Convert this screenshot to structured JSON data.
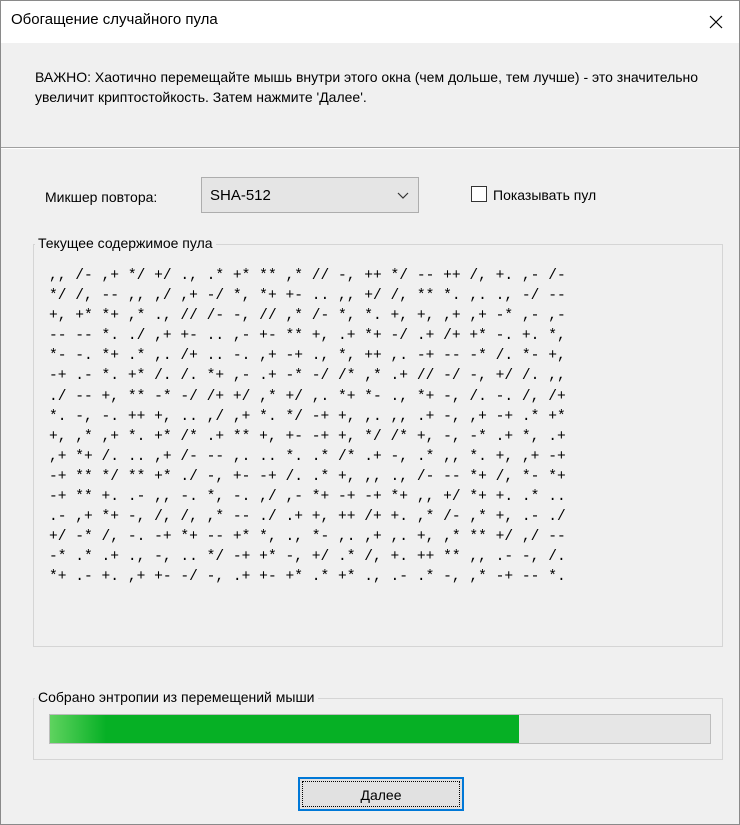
{
  "window": {
    "title": "Обогащение случайного пула",
    "close_icon": "close-icon"
  },
  "important_text": "ВАЖНО: Хаотично перемещайте мышь внутри этого окна (чем дольше, тем лучше) - это значительно увеличит криптостойкость. Затем нажмите 'Далее'.",
  "mixer": {
    "label": "Микшер повтора:",
    "value": "SHA-512",
    "arrow_icon": "chevron-down-icon"
  },
  "show_pool": {
    "label": "Показывать пул",
    "checked": false
  },
  "pool": {
    "group_title": "Текущее содержимое пула",
    "lines": [
      ",, /- ,+ */ +/ ., .* +* ** ,* // -, ++ */ -- ++ /, +. ,- /-",
      "*/ /, -- ,, ,/ ,+ -/ *, *+ +- .. ,, +/ /, ** *. ,. ., -/ --",
      "+, +* *+ ,* ., // /- -, // ,* /- *, *. +, +, ,+ ,+ -* ,- ,-",
      "-- -- *. ./ ,+ +- .. ,- +- ** +, .+ *+ -/ .+ /+ +* -. +. *,",
      "*- -. *+ .* ,. /+ .. -. ,+ -+ ., *, ++ ,. -+ -- -* /. *- +,",
      "-+ .- *. +* /. /. *+ ,- .+ -* -/ /* ,* .+ // -/ -, +/ /. ,,",
      "./ -- +, ** -* -/ /+ +/ ,* +/ ,. *+ *- ., *+ -, /. -. /, /+",
      "*. -, -. ++ +, .. ,/ ,+ *. */ -+ +, ,. ,, .+ -, ,+ -+ .* +*",
      "+, ,* ,+ *. +* /* .+ ** +, +- -+ +, */ /* +, -, -* .+ *, .+",
      ",+ *+ /. .. ,+ /- -- ,. .. *. .* /* .+ -, .* ,, *. +, ,+ -+",
      "-+ ** */ ** +* ./ -, +- -+ /. .* +, ,, ., /- -- *+ /, *- *+",
      "-+ ** +. .- ,, -. *, -. ,/ ,- *+ -+ -+ *+ ,, +/ *+ +. .* ..",
      ".- ,+ *+ -, /, /, ,* -- ./ .+ +, ++ /+ +. ,* /- ,* +, .- ./",
      "+/ -* /, -. -+ *+ -- +* *, ., *- ,. ,+ ,. +, ,* ** +/ ,/ --",
      "-* .* .+ ., -, .. */ -+ +* -, +/ .* /, +. ++ ** ,, .- -, /.",
      "*+ .- +. ,+ +- -/ -, .+ +- +* .* +* ., .- .* -, ,* -+ -- *."
    ]
  },
  "entropy": {
    "group_title": "Собрано энтропии из перемещений мыши",
    "progress_fraction": 0.71
  },
  "next_button": {
    "label_mnemonic": "Д",
    "label_rest": "алее"
  },
  "colors": {
    "progress_fill": "#06b025",
    "focus_border": "#0078d7"
  }
}
